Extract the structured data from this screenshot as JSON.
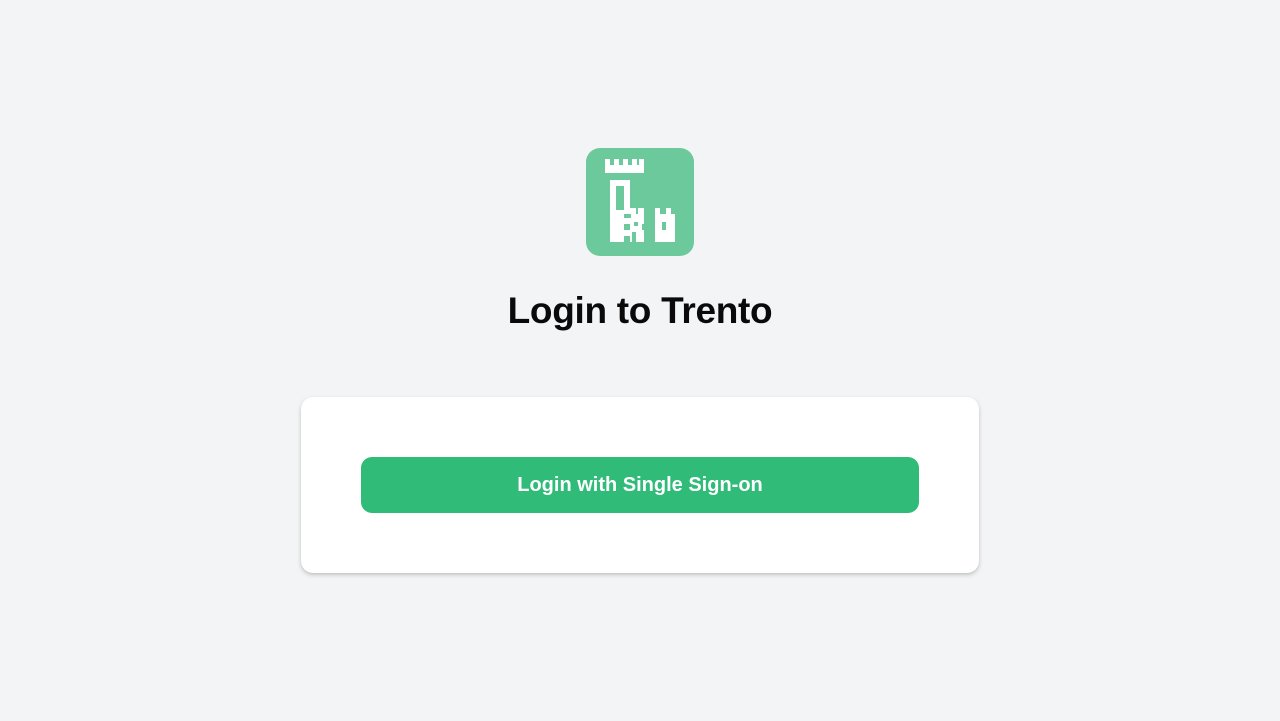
{
  "logo": {
    "icon": "trento-castle-logo",
    "background_color": "#6cc99b"
  },
  "page": {
    "title": "Login to Trento"
  },
  "login_card": {
    "sso_button_label": "Login with Single Sign-on",
    "button_color": "#30bb79"
  }
}
